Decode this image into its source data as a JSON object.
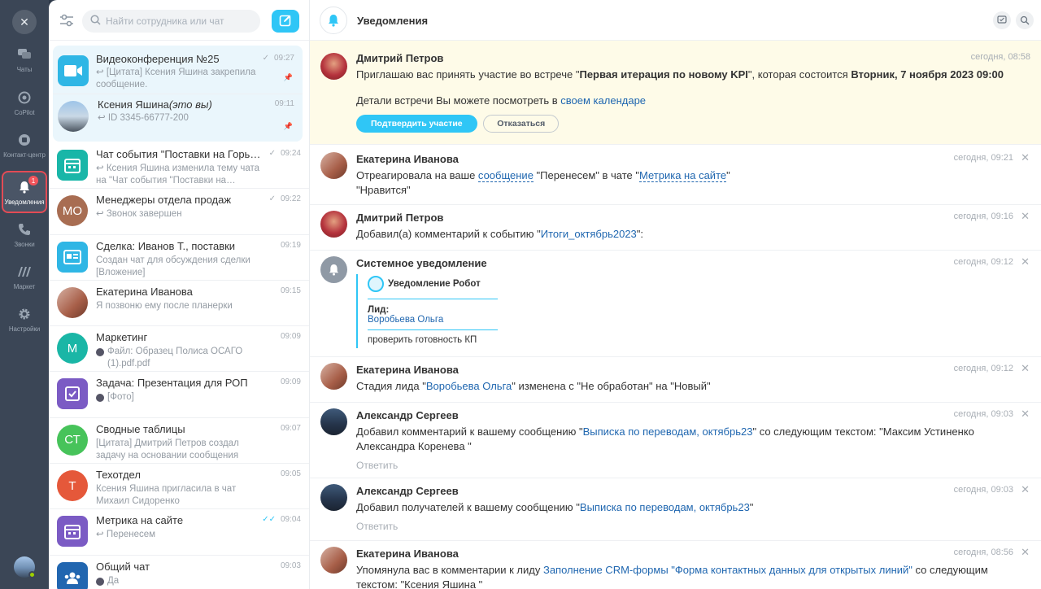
{
  "rail": {
    "items": [
      {
        "label": "Чаты",
        "icon": "chat-icon"
      },
      {
        "label": "CoPilot",
        "icon": "copilot-icon"
      },
      {
        "label": "Контакт-центр",
        "icon": "contact-center-icon"
      },
      {
        "label": "Уведомления",
        "icon": "bell-icon",
        "badge": "1"
      },
      {
        "label": "Звонки",
        "icon": "phone-icon"
      },
      {
        "label": "Маркет",
        "icon": "market-icon"
      },
      {
        "label": "Настройки",
        "icon": "gear-icon"
      }
    ]
  },
  "search": {
    "placeholder": "Найти сотрудника или чат"
  },
  "pinned": [
    {
      "title": "Видеоконференция №25",
      "time": "09:27",
      "sub": "↩ [Цитата] Ксения Яшина закрепила сообщение.",
      "check": "✓"
    },
    {
      "title": "Ксения Яшина",
      "title_suffix": "(это вы)",
      "time": "09:11",
      "sub": "↩ ID 3345-66777-200"
    }
  ],
  "chats": [
    {
      "title": "Чат события \"Поставки на Горь…",
      "time": "09:24",
      "check": "✓",
      "sub": "↩ Ксения Яшина изменила тему чата на \"Чат события \"Поставки на…"
    },
    {
      "title": "Менеджеры отдела продаж",
      "time": "09:22",
      "check": "✓",
      "initials": "МО",
      "sub": "↩ Звонок завершен"
    },
    {
      "title": "Сделка: Иванов Т., поставки",
      "time": "09:19",
      "sub": "Создан чат для обсуждения сделки [Вложение]"
    },
    {
      "title": "Екатерина Иванова",
      "time": "09:15",
      "sub": "Я позвоню ему после планерки"
    },
    {
      "title": "Маркетинг",
      "time": "09:09",
      "initials": "М",
      "sub": "Файл: Образец Полиса ОСАГО (1).pdf.pdf"
    },
    {
      "title": "Задача: Презентация для РОП",
      "time": "09:09",
      "sub": "[Фото]"
    },
    {
      "title": "Сводные таблицы",
      "time": "09:07",
      "initials": "СТ",
      "sub": "[Цитата] Дмитрий Петров создал задачу на основании сообщения"
    },
    {
      "title": "Техотдел",
      "time": "09:05",
      "initials": "Т",
      "sub": "Ксения Яшина пригласила в чат Михаил Сидоренко"
    },
    {
      "title": "Метрика на сайте",
      "time": "09:04",
      "check": "✓✓",
      "sub": "↩ Перенесем"
    },
    {
      "title": "Общий чат",
      "time": "09:03",
      "sub": "Да"
    }
  ],
  "header": {
    "title": "Уведомления"
  },
  "notifications": [
    {
      "name": "Дмитрий Петров",
      "time": "сегодня, 08:58",
      "t1": "Приглашаю вас принять участие во встрече \"",
      "b1": "Первая итерация по новому KPI",
      "t2": "\", которая состоится ",
      "b2": "Вторник, 7 ноября 2023 09:00",
      "t3": "Детали встречи Вы можете посмотреть в ",
      "link": "своем календаре",
      "accept": "Подтвердить участие",
      "decline": "Отказаться"
    },
    {
      "name": "Екатерина Иванова",
      "time": "сегодня, 09:21",
      "t1": "Отреагировала на ваше ",
      "l1": "сообщение",
      "t2": " \"Перенесем\" в чате \"",
      "l2": "Метрика на сайте",
      "t3": "\"",
      "t4": "\"Нравится\""
    },
    {
      "name": "Дмитрий Петров",
      "time": "сегодня, 09:16",
      "t1": "Добавил(а) комментарий к событию \"",
      "l1": "Итоги_октябрь2023",
      "t2": "\":"
    },
    {
      "name": "Системное уведомление",
      "time": "сегодня, 09:12",
      "card_title": "Уведомление Робот",
      "card_label": "Лид:",
      "card_value": "Воробьева Ольга",
      "card_footer": "проверить готовность КП"
    },
    {
      "name": "Екатерина Иванова",
      "time": "сегодня, 09:12",
      "t1": "Стадия лида \"",
      "l1": "Воробьева Ольга",
      "t2": "\" изменена с \"Не обработан\" на \"Новый\""
    },
    {
      "name": "Александр Сергеев",
      "time": "сегодня, 09:03",
      "t1": "Добавил комментарий к вашему сообщению \"",
      "l1": "Выписка по переводам, октябрь23",
      "t2": "\" со следующим текстом: \"Максим Устиненко Александра Коренева \"",
      "reply": "Ответить"
    },
    {
      "name": "Александр Сергеев",
      "time": "сегодня, 09:03",
      "t1": "Добавил получателей к вашему сообщению \"",
      "l1": "Выписка по переводам, октябрь23",
      "t2": "\"",
      "reply": "Ответить"
    },
    {
      "name": "Екатерина Иванова",
      "time": "сегодня, 08:56",
      "t1": "Упомянула вас в комментарии к лиду ",
      "l1": "Заполнение CRM-формы \"Форма контактных данных для открытых линий\"",
      "t2": " со следующим текстом: \"Ксения Яшина \""
    }
  ],
  "colors": {
    "accent": "#2fc6f6",
    "link": "#2067b0",
    "highlight": "#fefbe8",
    "alert": "#e34b55"
  }
}
